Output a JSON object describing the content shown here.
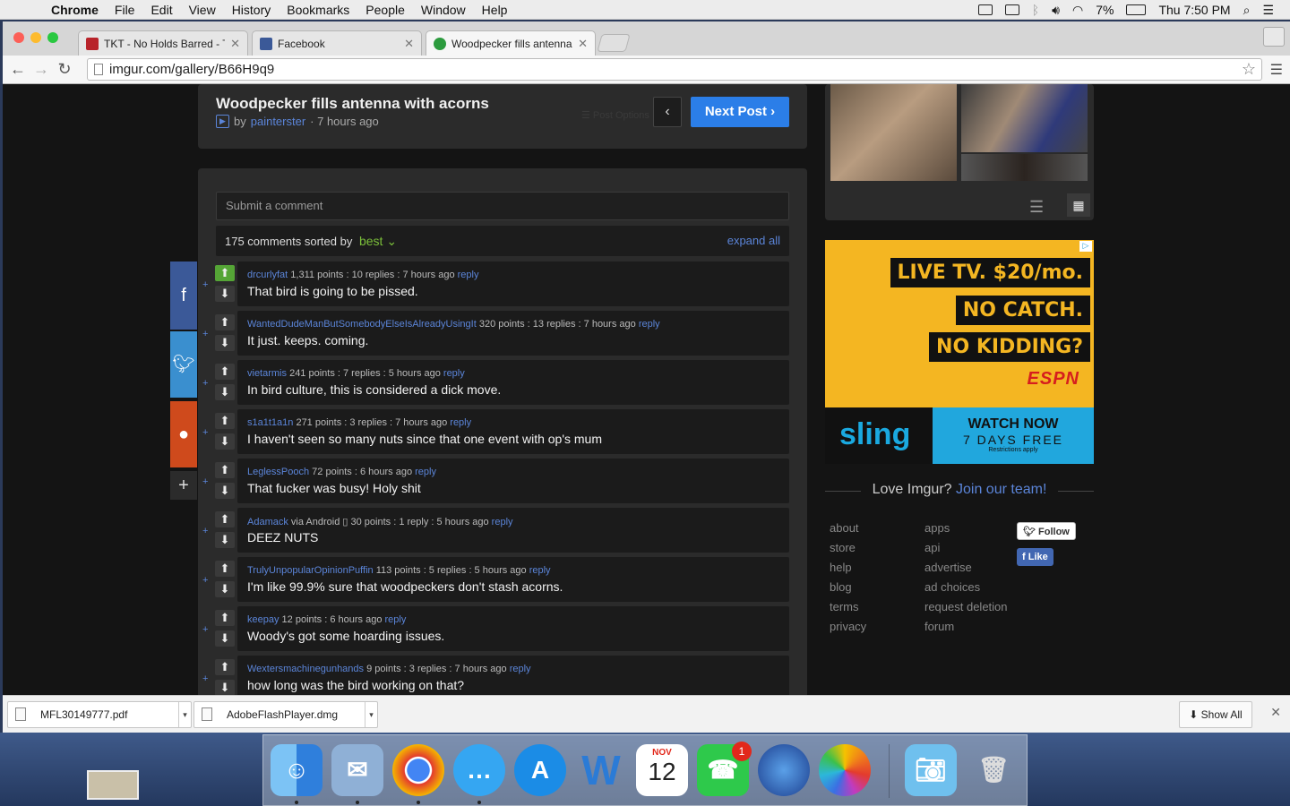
{
  "menubar": {
    "app": "Chrome",
    "items": [
      "File",
      "Edit",
      "View",
      "History",
      "Bookmarks",
      "People",
      "Window",
      "Help"
    ],
    "battery": "7%",
    "clock": "Thu 7:50 PM"
  },
  "tabs": [
    {
      "title": "TKT - No Holds Barred - Th",
      "favicon_color": "#b8232a"
    },
    {
      "title": "Facebook",
      "favicon_color": "#3b5998"
    },
    {
      "title": "Woodpecker fills antenna w",
      "favicon_color": "#2c9b3e"
    }
  ],
  "address": {
    "url": "imgur.com/gallery/B66H9q9"
  },
  "post": {
    "title": "Woodpecker fills antenna with acorns",
    "by": "by",
    "author": "painterster",
    "time": "· 7 hours ago",
    "post_options": "Post Options",
    "next": "Next Post"
  },
  "comments_header": {
    "submit_placeholder": "Submit a comment",
    "count": "175 comments sorted by",
    "sort": "best",
    "expand": "expand all"
  },
  "comments": [
    {
      "user": "drcurlyfat",
      "meta": " 1,311 points : 10 replies : 7 hours ago ",
      "reply": "reply",
      "text": "That bird is going to be pissed.",
      "upvoted": true
    },
    {
      "user": "WantedDudeManButSomebodyElseIsAlreadyUsingIt",
      "meta": " 320 points : 13 replies : 7 hours ago ",
      "reply": "reply",
      "text": "It just. keeps. coming."
    },
    {
      "user": "vietarmis",
      "meta": " 241 points : 7 replies : 5 hours ago ",
      "reply": "reply",
      "text": "In bird culture, this is considered a dick move."
    },
    {
      "user": "s1a1t1a1n",
      "meta": " 271 points : 3 replies : 7 hours ago ",
      "reply": "reply",
      "text": "I haven't seen so many nuts since that one event with op's mum"
    },
    {
      "user": "LeglessPooch",
      "meta": " 72 points : 6 hours ago ",
      "reply": "reply",
      "text": "That fucker was busy! Holy shit"
    },
    {
      "user": "Adamack",
      "meta": " via Android ▯ 30 points : 1 reply : 5 hours ago ",
      "reply": "reply",
      "text": "DEEZ NUTS"
    },
    {
      "user": "TrulyUnpopularOpinionPuffin",
      "meta": " 113 points : 5 replies : 5 hours ago ",
      "reply": "reply",
      "text": "I'm like 99.9% sure that woodpeckers don't stash acorns."
    },
    {
      "user": "keepay",
      "meta": " 12 points : 6 hours ago ",
      "reply": "reply",
      "text": "Woody's got some hoarding issues."
    },
    {
      "user": "Wextersmachinegunhands",
      "meta": " 9 points : 3 replies : 7 hours ago ",
      "reply": "reply",
      "text": "how long was the bird working on that?"
    }
  ],
  "ad": {
    "line1": "LIVE TV. $20/mo.",
    "line2": "NO CATCH.",
    "line3": "NO KIDDING?",
    "espn": "ESPN",
    "sling": "sling",
    "watch": "WATCH NOW",
    "days": "7 DAYS FREE",
    "restrictions": "Restrictions apply"
  },
  "footer": {
    "love": "Love Imgur?",
    "join": "Join our team!",
    "col1": [
      "about",
      "store",
      "help",
      "blog",
      "terms",
      "privacy"
    ],
    "col2": [
      "apps",
      "api",
      "advertise",
      "ad choices",
      "request deletion",
      "forum"
    ],
    "follow": "Follow",
    "like": "Like"
  },
  "downloads": {
    "items": [
      "MFL30149777.pdf",
      "AdobeFlashPlayer.dmg"
    ],
    "show_all": "Show All"
  },
  "dock": {
    "calendar_month": "NOV",
    "calendar_day": "12",
    "facetime_badge": "1"
  }
}
